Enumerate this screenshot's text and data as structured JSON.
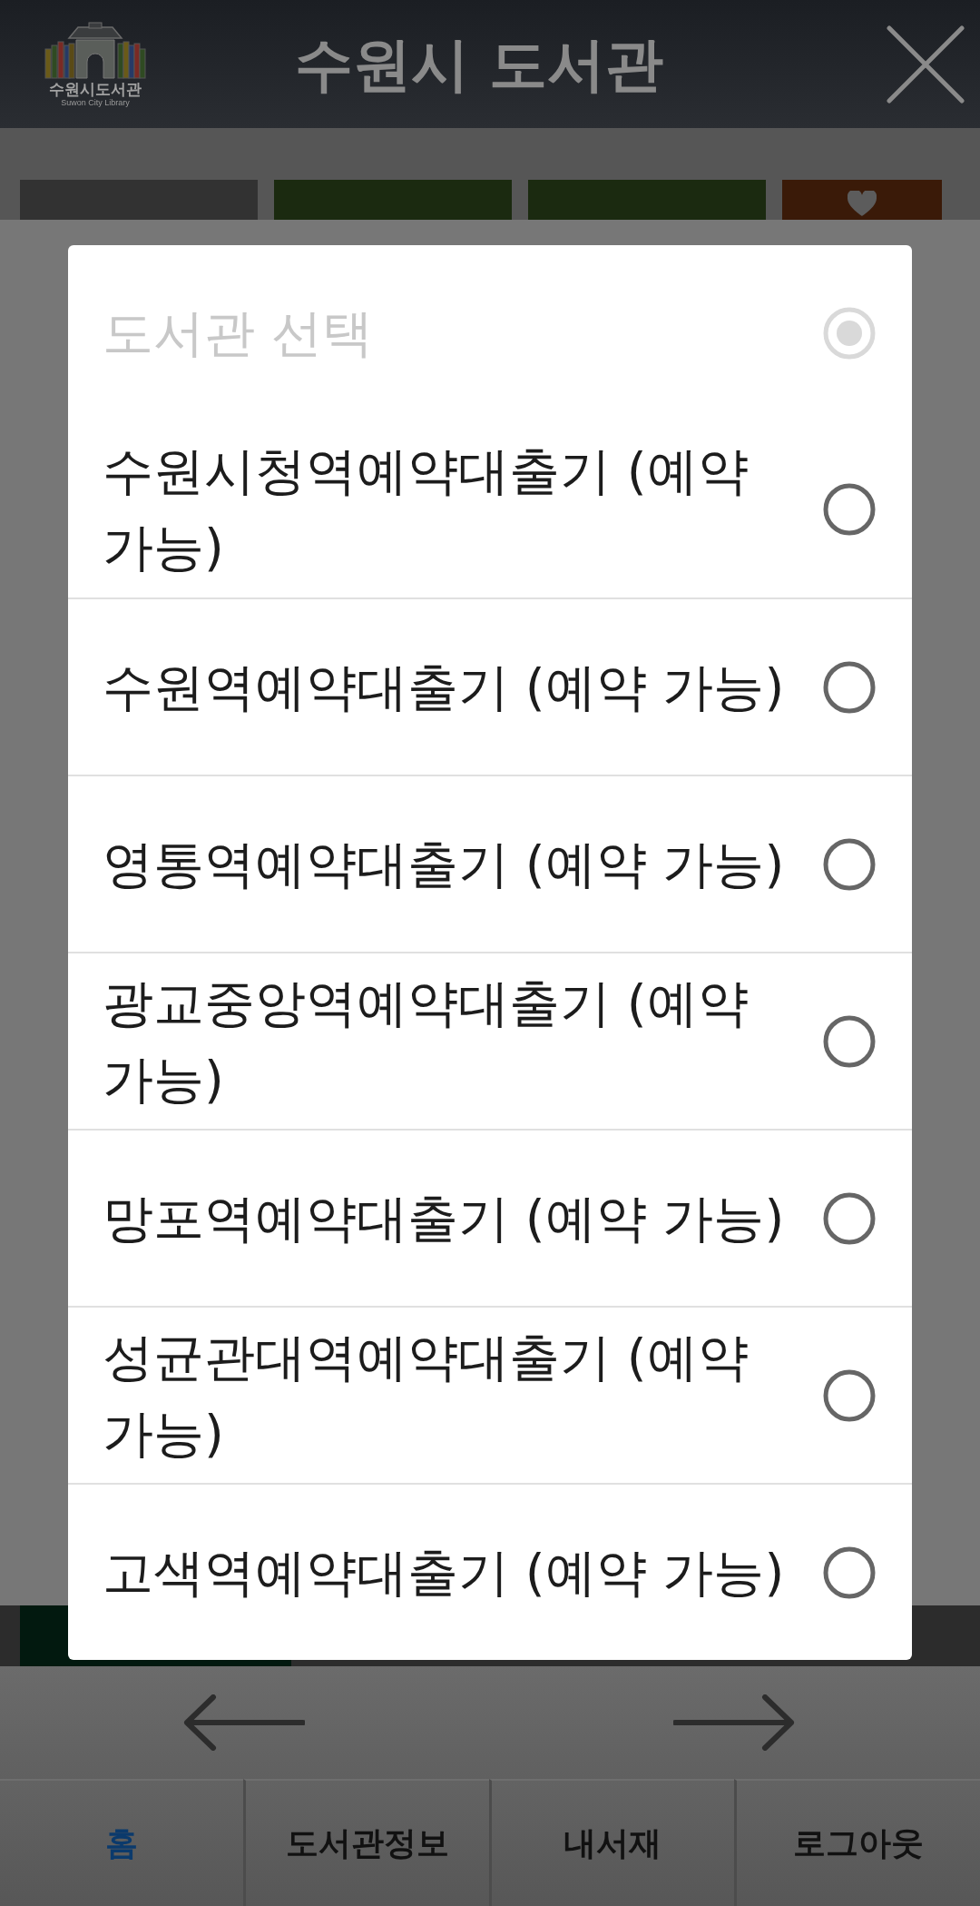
{
  "header": {
    "logo": {
      "text": "수원시도서관",
      "subtitle": "Suwon City Library"
    },
    "title": "수원시 도서관"
  },
  "background": {
    "action_buttons": [
      {
        "color": "#323232",
        "kind": "blank"
      },
      {
        "color": "#1b2a10",
        "kind": "blank"
      },
      {
        "color": "#1b2a10",
        "kind": "blank"
      },
      {
        "color": "#3a1a08",
        "kind": "heart"
      }
    ]
  },
  "dialog": {
    "options": [
      {
        "label": "도서관 선택",
        "selected": true,
        "disabled": true
      },
      {
        "label": "수원시청역예약대출기 (예약 가능)",
        "selected": false,
        "disabled": false
      },
      {
        "label": "수원역예약대출기 (예약 가능)",
        "selected": false,
        "disabled": false
      },
      {
        "label": "영통역예약대출기 (예약 가능)",
        "selected": false,
        "disabled": false
      },
      {
        "label": "광교중앙역예약대출기 (예약 가능)",
        "selected": false,
        "disabled": false
      },
      {
        "label": "망포역예약대출기 (예약 가능)",
        "selected": false,
        "disabled": false
      },
      {
        "label": "성균관대역예약대출기 (예약 가능)",
        "selected": false,
        "disabled": false
      },
      {
        "label": "고색역예약대출기 (예약 가능)",
        "selected": false,
        "disabled": false
      }
    ]
  },
  "nav_tabs": [
    {
      "label": "홈",
      "selected": true
    },
    {
      "label": "도서관정보",
      "selected": false
    },
    {
      "label": "내서재",
      "selected": false
    },
    {
      "label": "로그아웃",
      "selected": false
    }
  ]
}
